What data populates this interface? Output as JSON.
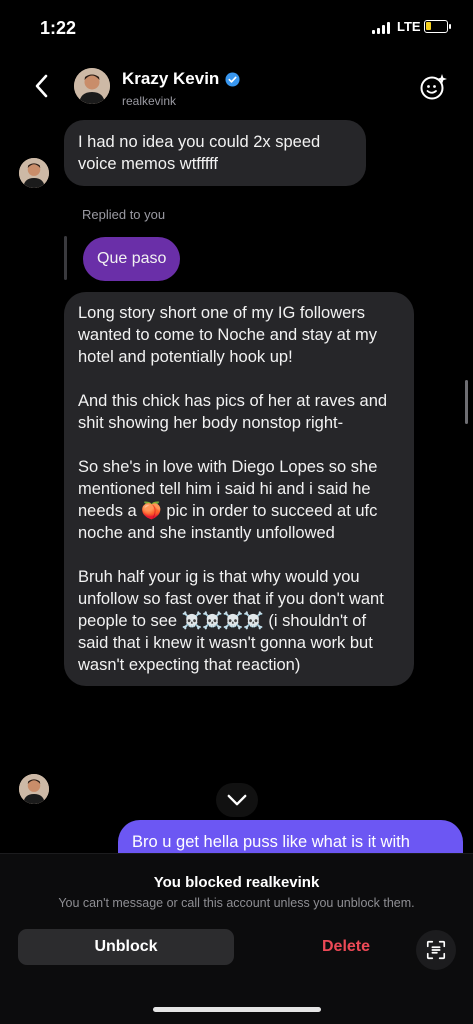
{
  "status_bar": {
    "time": "1:22",
    "network": "LTE",
    "battery_level": 0.25,
    "battery_color": "#f5d020"
  },
  "header": {
    "name": "Krazy Kevin",
    "handle": "realkevink",
    "back_icon": "chevron-left-icon",
    "verified_icon": "verified-badge-icon",
    "effects_icon": "sticker-effects-icon"
  },
  "messages": {
    "first": "I had no idea you could 2x speed\nvoice memos wtfffff",
    "replied_label": "Replied to you",
    "reply_text": "Que paso",
    "long_paragraphs": [
      "Long story short one of my IG followers wanted to come to Noche and stay at my hotel and potentially hook up!",
      "And this chick has pics of her at raves and shit showing her body nonstop right-",
      "So she's in love with Diego Lopes so she mentioned tell him i said hi and i said he needs a 🍑 pic in order to succeed at ufc noche and she instantly unfollowed",
      "Bruh half your ig is that why would you unfollow so fast over that if you don't want people to see ☠️☠️☠️☠️ (i shouldn't of said that i knew it wasn't gonna work but wasn't expecting that reaction)"
    ],
    "outgoing": "Bro u get hella puss like what is it with"
  },
  "footer": {
    "title": "You blocked realkevink",
    "subtitle": "You can't message or call this account unless you unblock them.",
    "unblock_label": "Unblock",
    "delete_label": "Delete",
    "scan_icon": "scan-text-icon"
  },
  "colors": {
    "incoming_bubble": "#262629",
    "reply_bubble": "#6a2fa8",
    "outgoing_bubble": "#6c57f3",
    "delete": "#ed4956",
    "verified": "#3897f0"
  }
}
